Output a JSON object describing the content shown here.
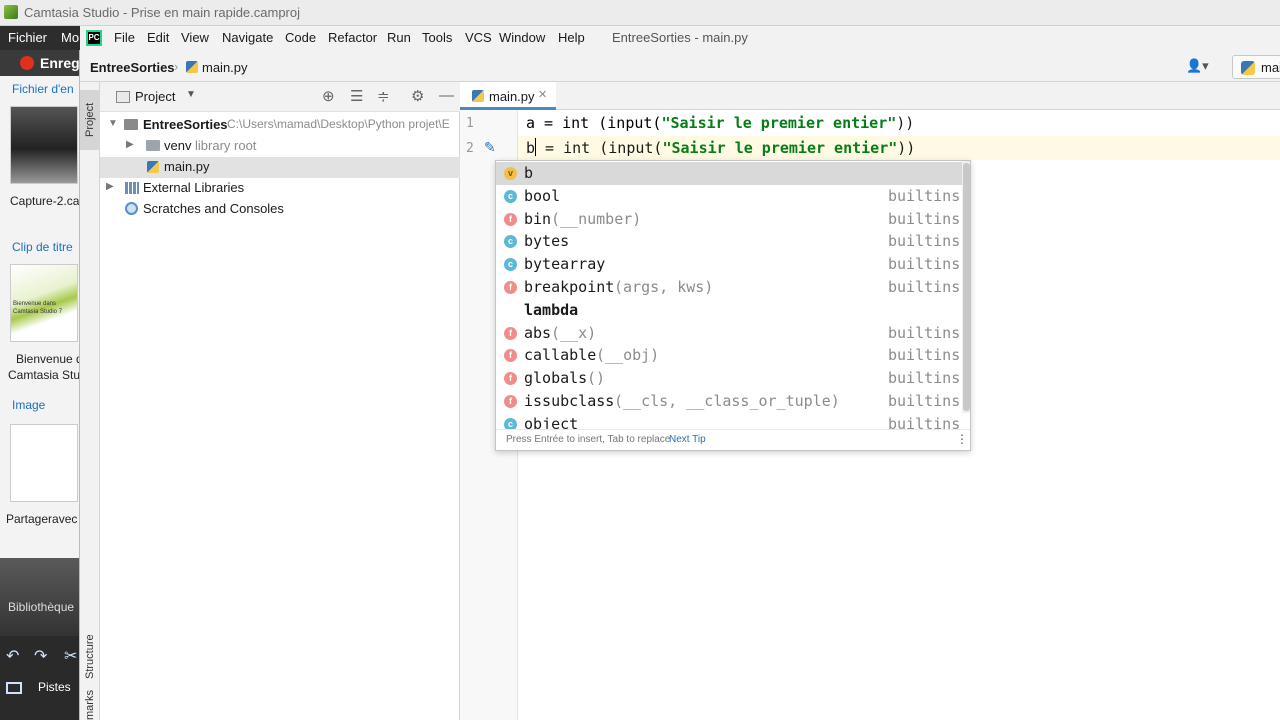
{
  "camtasia": {
    "title": "Camtasia Studio - Prise en main rapide.camproj",
    "menu": [
      "Fichier",
      "Mo"
    ],
    "record_label": "Enreg",
    "sections": [
      "Fichier d'en",
      "Clip de titre",
      "Image"
    ],
    "captions": [
      "Capture-2.ca",
      "Bienvenue d",
      "Camtasia Stu",
      "Partageravec"
    ],
    "thumb_text_1": "Bienvenue dans",
    "thumb_text_2": "Camtasia Studio 7",
    "library_label": "Bibliothèque",
    "tracks_label": "Pistes"
  },
  "pycharm": {
    "menu": [
      "File",
      "Edit",
      "View",
      "Navigate",
      "Code",
      "Refactor",
      "Run",
      "Tools",
      "VCS",
      "Window",
      "Help"
    ],
    "window_title": "EntreeSorties - main.py",
    "breadcrumb": {
      "project": "EntreeSorties",
      "file": "main.py"
    },
    "run_config": "mai",
    "side_tabs": {
      "project": "Project",
      "structure": "Structure",
      "bookmarks": "marks"
    },
    "project_panel": {
      "title": "Project",
      "tree": {
        "root_name": "EntreeSorties",
        "root_path": "C:\\Users\\mamad\\Desktop\\Python projet\\E",
        "venv": "venv",
        "venv_note": "library root",
        "file": "main.py",
        "external": "External Libraries",
        "scratches": "Scratches and Consoles"
      }
    },
    "editor": {
      "tab": "main.py",
      "lines": [
        {
          "num": "1",
          "pre": "a = int (input(",
          "str": "\"Saisir le premier entier\"",
          "post": "))"
        },
        {
          "num": "2",
          "pre": "b",
          "mid": " = int (input(",
          "str": "\"Saisir le premier entier\"",
          "post": "))"
        }
      ]
    },
    "completion": {
      "items": [
        {
          "kind": "v",
          "name": "b",
          "args": "",
          "type": ""
        },
        {
          "kind": "c",
          "name": "bool",
          "args": "",
          "type": "builtins"
        },
        {
          "kind": "f",
          "name": "bin",
          "args": "(__number)",
          "type": "builtins"
        },
        {
          "kind": "c",
          "name": "bytes",
          "args": "",
          "type": "builtins"
        },
        {
          "kind": "c",
          "name": "bytearray",
          "args": "",
          "type": "builtins"
        },
        {
          "kind": "f",
          "name": "breakpoint",
          "args": "(args, kws)",
          "type": "builtins"
        },
        {
          "kind": "",
          "name": "lambda",
          "args": "",
          "type": ""
        },
        {
          "kind": "f",
          "name": "abs",
          "args": "(__x)",
          "type": "builtins"
        },
        {
          "kind": "f",
          "name": "callable",
          "args": "(__obj)",
          "type": "builtins"
        },
        {
          "kind": "f",
          "name": "globals",
          "args": "()",
          "type": "builtins"
        },
        {
          "kind": "f",
          "name": "issubclass",
          "args": "(__cls, __class_or_tuple)",
          "type": "builtins"
        },
        {
          "kind": "c",
          "name": "object",
          "args": "",
          "type": "builtins"
        }
      ],
      "hint": "Press Entrée to insert, Tab to replace",
      "tip": "Next Tip"
    }
  }
}
